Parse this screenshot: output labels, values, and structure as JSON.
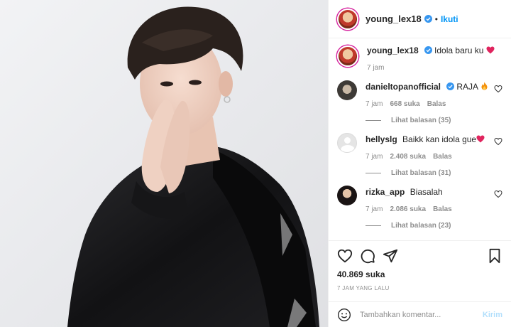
{
  "post": {
    "username": "young_lex18",
    "follow_label": "Ikuti",
    "dot": "•",
    "caption": "Idola baru ku",
    "caption_time": "7 jam"
  },
  "comments": [
    {
      "username": "danieltopanofficial",
      "text": "RAJA",
      "time": "7 jam",
      "likes": "668 suka",
      "reply": "Balas",
      "view_replies": "Lihat balasan (35)"
    },
    {
      "username": "hellyslg",
      "text": "Baikk kan idola gue",
      "time": "7 jam",
      "likes": "2.408 suka",
      "reply": "Balas",
      "view_replies": "Lihat balasan (31)"
    },
    {
      "username": "rizka_app",
      "text": "Biasalah",
      "time": "7 jam",
      "likes": "2.086 suka",
      "reply": "Balas",
      "view_replies": "Lihat balasan (23)"
    }
  ],
  "actions": {
    "likes": "40.869 suka",
    "timestamp": "7 JAM YANG LALU"
  },
  "add_comment": {
    "placeholder": "Tambahkan komentar...",
    "post_label": "Kirim"
  },
  "colors": {
    "accent": "#0095f6",
    "verified": "#3897f0",
    "heart": "#ed4956"
  },
  "icons": [
    "verified-icon",
    "heart-icon",
    "comment-icon",
    "share-icon",
    "bookmark-icon",
    "emoji-icon",
    "fire-emoji"
  ]
}
